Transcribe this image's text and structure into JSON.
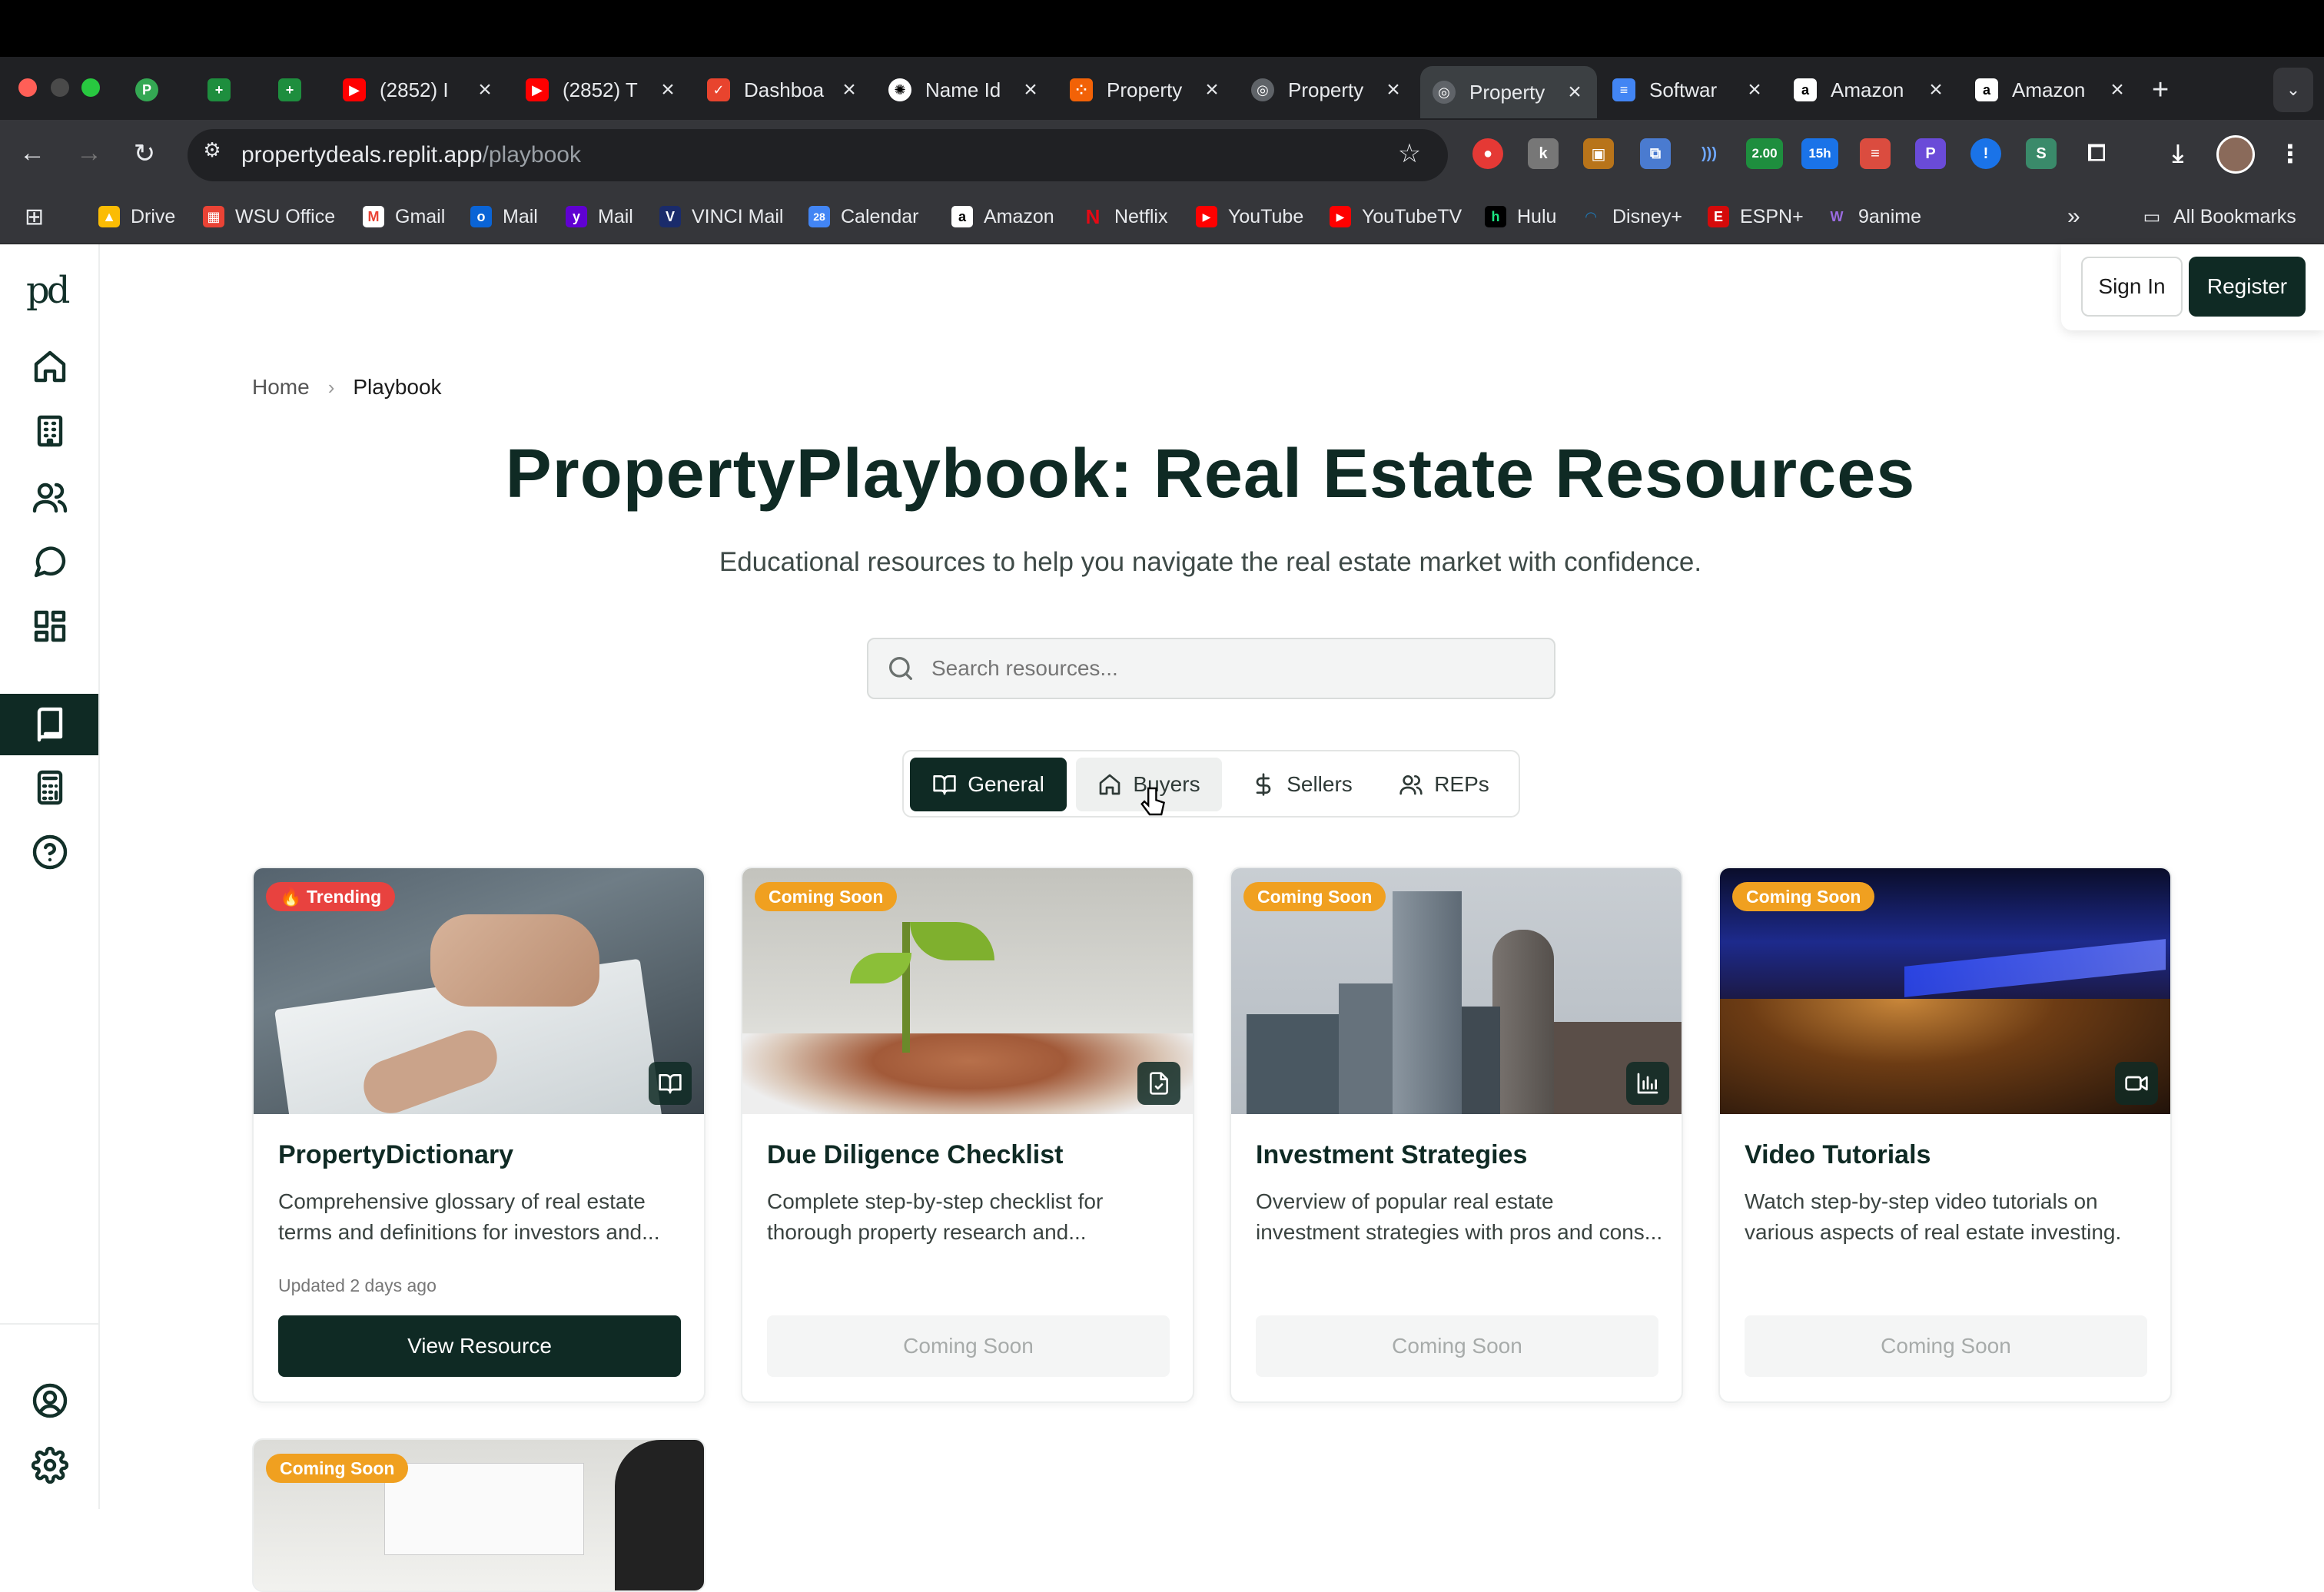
{
  "browser": {
    "tabs": [
      {
        "label": "",
        "favicon": "P"
      },
      {
        "label": "",
        "favicon": "sheets"
      },
      {
        "label": "",
        "favicon": "sheets"
      },
      {
        "label": "(2852) I",
        "favicon": "youtube"
      },
      {
        "label": "(2852) T",
        "favicon": "youtube"
      },
      {
        "label": "Dashboa",
        "favicon": "dashboard"
      },
      {
        "label": "Name Id",
        "favicon": "openai"
      },
      {
        "label": "Property",
        "favicon": "replit"
      },
      {
        "label": "Property",
        "favicon": "globe"
      },
      {
        "label": "Property",
        "favicon": "globe"
      },
      {
        "label": "Softwar",
        "favicon": "docs"
      },
      {
        "label": "Amazon",
        "favicon": "amazon"
      },
      {
        "label": "Amazon",
        "favicon": "amazon"
      }
    ],
    "url_host": "propertydeals.replit.app",
    "url_path": "/playbook",
    "extension_badge": "2.00",
    "extension_badge2": "15h",
    "bookmarks": [
      "Drive",
      "WSU Office",
      "Gmail",
      "Mail",
      "Mail",
      "VINCI Mail",
      "Calendar",
      "Amazon",
      "Netflix",
      "YouTube",
      "YouTubeTV",
      "Hulu",
      "Disney+",
      "ESPN+",
      "9anime"
    ],
    "all_bookmarks": "All Bookmarks",
    "overflow": "»"
  },
  "app": {
    "logo": "pd",
    "auth": {
      "sign_in": "Sign In",
      "register": "Register"
    },
    "breadcrumb": {
      "home": "Home",
      "separator": "›",
      "current": "Playbook"
    },
    "title": "PropertyPlaybook: Real Estate Resources",
    "subtitle": "Educational resources to help you navigate the real estate market with confidence.",
    "search_placeholder": "Search resources...",
    "filters": [
      "General",
      "Buyers",
      "Sellers",
      "REPs"
    ],
    "cards": [
      {
        "badge": "🔥 Trending",
        "title": "PropertyDictionary",
        "desc": "Comprehensive glossary of real estate terms and definitions for investors and...",
        "updated": "Updated 2 days ago",
        "button": "View Resource",
        "type_icon": "book-icon"
      },
      {
        "badge": "Coming Soon",
        "title": "Due Diligence Checklist",
        "desc": "Complete step-by-step checklist for thorough property research and...",
        "button": "Coming Soon",
        "type_icon": "file-check-icon"
      },
      {
        "badge": "Coming Soon",
        "title": "Investment Strategies",
        "desc": "Overview of popular real estate investment strategies with pros and cons...",
        "button": "Coming Soon",
        "type_icon": "bar-chart-icon"
      },
      {
        "badge": "Coming Soon",
        "title": "Video Tutorials",
        "desc": "Watch step-by-step video tutorials on various aspects of real estate investing.",
        "button": "Coming Soon",
        "type_icon": "video-icon"
      }
    ],
    "card5_badge": "Coming Soon"
  },
  "colors": {
    "brand": "#0f2a24",
    "trending": "#e8423f",
    "coming_soon": "#f0a020"
  }
}
